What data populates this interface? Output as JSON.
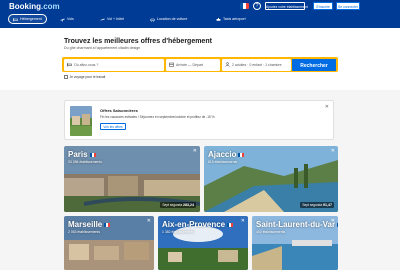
{
  "header": {
    "logo": "Booking",
    "logo_dot": ".com",
    "btn_register_property": "Ajoutez votre établissement",
    "btn_signup": "S'inscrire",
    "btn_login": "Se connecter"
  },
  "nav": [
    {
      "label": "Hébergement",
      "icon": "bed-icon"
    },
    {
      "label": "Vols",
      "icon": "plane-icon"
    },
    {
      "label": "Vol + hôtel",
      "icon": "plane-bed-icon"
    },
    {
      "label": "Location de voiture",
      "icon": "car-icon"
    },
    {
      "label": "Taxis aéroport",
      "icon": "taxi-icon"
    }
  ],
  "hero": {
    "title": "Trouvez les meilleures offres d'hébergement",
    "subtitle": "Du gîte charmant à l'appartement citadin design"
  },
  "search": {
    "destination_placeholder": "Où allez-vous ?",
    "dates_label": "Arrivée — Départ",
    "guests_label": "2 adultes · 0 enfant · 1 chambre",
    "button_label": "Rechercher",
    "checkbox_label": "Je voyage pour le travail"
  },
  "promo": {
    "title": "Offres Saisonnières",
    "text": "Fin les vacances estivales ! Séjournez en septembre/octobre et profitez de -15 %.",
    "button": "Voir les offres"
  },
  "destinations": [
    {
      "name": "Paris",
      "count": "33 286 établissements",
      "price_label": "Sept segunda",
      "price": "283,24"
    },
    {
      "name": "Ajaccio",
      "count": "815 établissements",
      "price_label": "Sept segunda",
      "price": "91,47"
    },
    {
      "name": "Marseille",
      "count": "2 063 établissements"
    },
    {
      "name": "Aix-en-Provence",
      "count": "1 382 établissements"
    },
    {
      "name": "Saint-Laurent-du-Var",
      "count": "402 établissements"
    }
  ]
}
